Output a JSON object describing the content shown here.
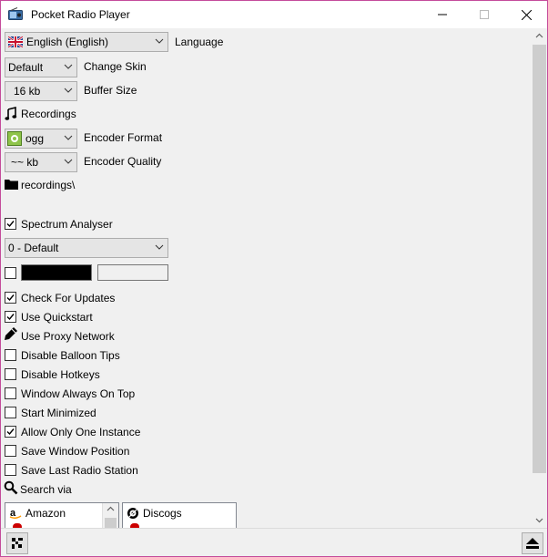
{
  "window": {
    "title": "Pocket Radio Player"
  },
  "settings": {
    "language": {
      "value": "English (English)",
      "label": "Language"
    },
    "skin": {
      "value": "Default",
      "label": "Change Skin"
    },
    "buffer": {
      "value": "16 kb",
      "label": "Buffer Size"
    },
    "recordings_label": "Recordings",
    "encoder_format": {
      "value": "ogg",
      "label": "Encoder Format"
    },
    "encoder_quality": {
      "value": "~~ kb",
      "label": "Encoder Quality"
    },
    "recordings_folder": "recordings\\",
    "spectrum_analyser": {
      "label": "Spectrum Analyser",
      "checked": true
    },
    "spectrum_preset": {
      "value": "0 - Default"
    },
    "color_checked": false,
    "colors": {
      "primary": "#000000",
      "secondary": "#f0f0f0"
    },
    "options": [
      {
        "label": "Check For Updates",
        "checked": true
      },
      {
        "label": "Use Quickstart",
        "checked": true
      },
      {
        "label": "Use Proxy Network",
        "checked": null
      },
      {
        "label": "Disable Balloon Tips",
        "checked": false
      },
      {
        "label": "Disable Hotkeys",
        "checked": false
      },
      {
        "label": "Window Always On Top",
        "checked": false
      },
      {
        "label": "Start Minimized",
        "checked": false
      },
      {
        "label": "Allow Only One Instance",
        "checked": true
      },
      {
        "label": "Save Window Position",
        "checked": false
      },
      {
        "label": "Save Last Radio Station",
        "checked": false
      }
    ],
    "search_via_label": "Search via",
    "search_left": [
      "Amazon"
    ],
    "search_right": [
      "Discogs"
    ]
  },
  "icons": {
    "app": "radio-icon",
    "recordings": "music-note-icon",
    "folder": "folder-icon",
    "proxy": "pencil-icon",
    "search": "magnifier-icon",
    "settings_btn": "tools-icon",
    "eject_btn": "eject-icon"
  }
}
